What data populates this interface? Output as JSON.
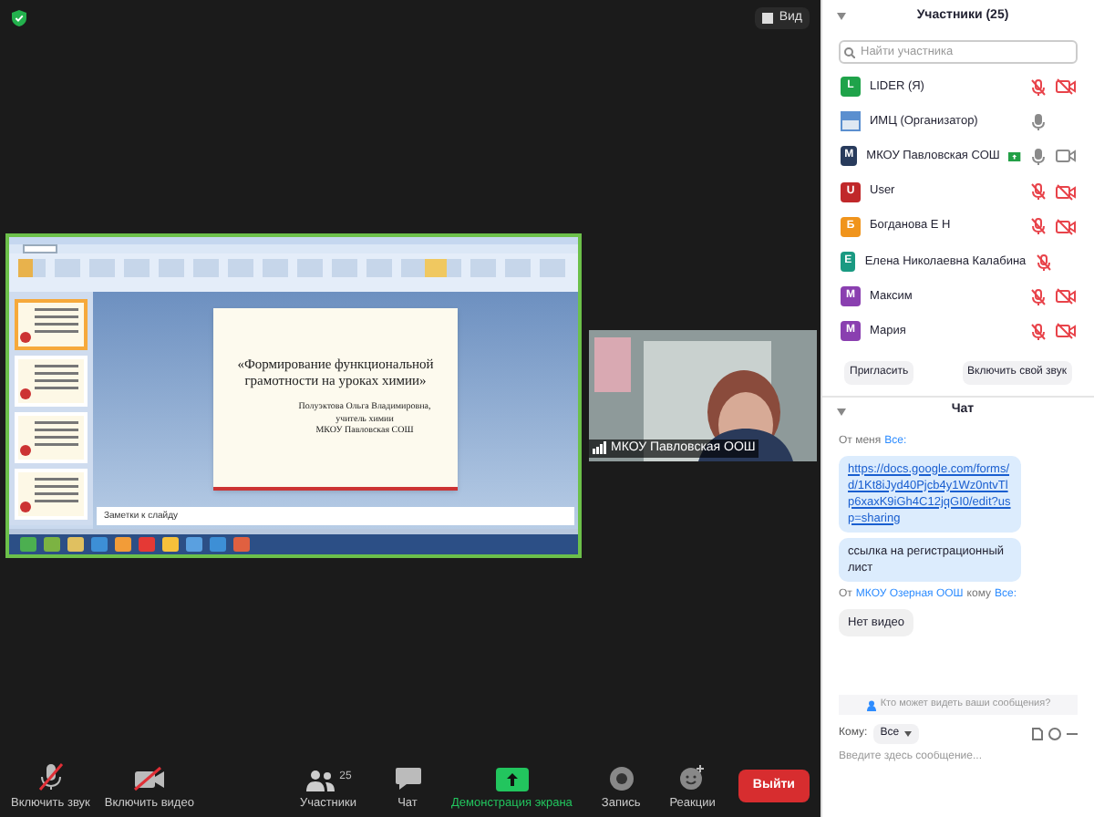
{
  "top_bar": {
    "view_button": "Вид"
  },
  "shared_screen": {
    "notes_placeholder": "Заметки к слайду",
    "slide": {
      "title": "«Формирование функциональной грамотности на уроках химии»",
      "author_lines": [
        "Полуэктова Ольга Владимировна,",
        "учитель химии",
        "МКОУ Павловская СОШ"
      ]
    }
  },
  "video_tile": {
    "name": "МКОУ Павловская ООШ"
  },
  "toolbar": {
    "items": [
      {
        "kind": "mic",
        "label": "Включить звук",
        "muted": true
      },
      {
        "kind": "video",
        "label": "Включить видео",
        "muted": true
      },
      {
        "kind": "participants",
        "label": "Участники",
        "count": "25"
      },
      {
        "kind": "chat",
        "label": "Чат"
      },
      {
        "kind": "share",
        "label": "Демонстрация экрана"
      },
      {
        "kind": "record",
        "label": "Запись"
      },
      {
        "kind": "reactions",
        "label": "Реакции"
      }
    ],
    "leave_button": "Выйти"
  },
  "participants_panel": {
    "title": "Участники (25)",
    "search": {
      "placeholder": "Найти участника"
    },
    "participants": [
      {
        "kind": "letter",
        "letter": "L",
        "color": "#1fa34a",
        "name": "LIDER (Я)",
        "sharing": false,
        "mic_muted": true,
        "video_off": true
      },
      {
        "kind": "photo",
        "name": "ИМЦ (Организатор)",
        "sharing": false,
        "mic_muted": false
      },
      {
        "kind": "letter",
        "letter": "М",
        "color": "#283b5c",
        "name": "МКОУ Павловская СОШ",
        "sharing": true,
        "mic_muted": false,
        "video_off": false
      },
      {
        "kind": "letter",
        "letter": "U",
        "color": "#c0282a",
        "name": "User",
        "sharing": false,
        "mic_muted": true,
        "video_off": true
      },
      {
        "kind": "letter",
        "letter": "Б",
        "color": "#f0941c",
        "name": "Богданова Е Н",
        "sharing": false,
        "mic_muted": true,
        "video_off": true
      },
      {
        "kind": "letter",
        "letter": "Е",
        "color": "#1a9a82",
        "name": "Елена Николаевна Калабина",
        "sharing": false,
        "mic_muted": true
      },
      {
        "kind": "letter",
        "letter": "М",
        "color": "#8a3fb0",
        "name": "Максим",
        "sharing": false,
        "mic_muted": true,
        "video_off": true
      },
      {
        "kind": "letter",
        "letter": "М",
        "color": "#8a3fb0",
        "name": "Мария",
        "sharing": false,
        "mic_muted": true,
        "video_off": true
      }
    ],
    "buttons": [
      "Пригласить",
      "Включить свой звук"
    ]
  },
  "chat_panel": {
    "title": "Чат",
    "messages": [
      {
        "from": "От меня",
        "to": "Все:",
        "parts": [
          {
            "kind": "link",
            "text": "https://docs.google.com/forms/d/1Kt8iJyd40Pjcb4y1Wz0ntvTlp6xaxK9iGh4C12jqGI0/edit?usp=sharing"
          },
          {
            "kind": "text",
            "text": "ссылка на регистрационный лист"
          }
        ],
        "mine": true
      },
      {
        "from": "От",
        "sender": "МКОУ Озерная ООШ",
        "to_word": "кому",
        "to": "Все:",
        "parts": [
          {
            "kind": "text",
            "text": "Нет видео"
          }
        ],
        "mine": false
      }
    ],
    "who_can_see": "Кто может видеть ваши сообщения?",
    "to_label": "Кому:",
    "recipient": "Все",
    "input": {
      "placeholder": "Введите здесь сообщение..."
    }
  }
}
